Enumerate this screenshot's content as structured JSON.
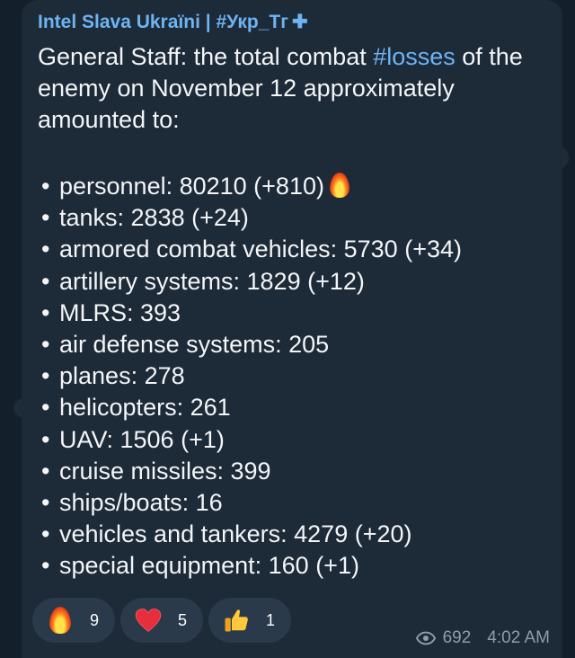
{
  "message": {
    "sender": "Intel Slava Ukraïni | #Укр_Тг",
    "intro_pre": "General Staff: the total combat ",
    "intro_hashtag": "#losses",
    "intro_post": " of the enemy on November 12 approximately amounted to:",
    "bullet": "•",
    "items": [
      {
        "text": "personnel: 80210 (+810)",
        "icon": "fire-icon"
      },
      {
        "text": "tanks: 2838 (+24)"
      },
      {
        "text": "armored combat vehicles: 5730 (+34)"
      },
      {
        "text": "artillery systems: 1829 (+12)"
      },
      {
        "text": "MLRS: 393"
      },
      {
        "text": "air defense systems: 205"
      },
      {
        "text": "planes: 278"
      },
      {
        "text": "helicopters: 261"
      },
      {
        "text": "UAV: 1506 (+1)"
      },
      {
        "text": "cruise missiles: 399"
      },
      {
        "text": "ships/boats: 16"
      },
      {
        "text": "vehicles and tankers: 4279 (+20)"
      },
      {
        "text": "special equipment: 160 (+1)"
      }
    ]
  },
  "reactions": [
    {
      "icon": "fire-icon",
      "count": "9"
    },
    {
      "icon": "heart-icon",
      "count": "5"
    },
    {
      "icon": "thumbs-up-icon",
      "count": "1"
    }
  ],
  "meta": {
    "views_icon": "eye-icon",
    "views": "692",
    "time": "4:02 AM"
  },
  "colors": {
    "bubble": "#1d2a38",
    "accent": "#6db4f2",
    "text": "#f3f5f7",
    "meta": "#8e9cab"
  }
}
